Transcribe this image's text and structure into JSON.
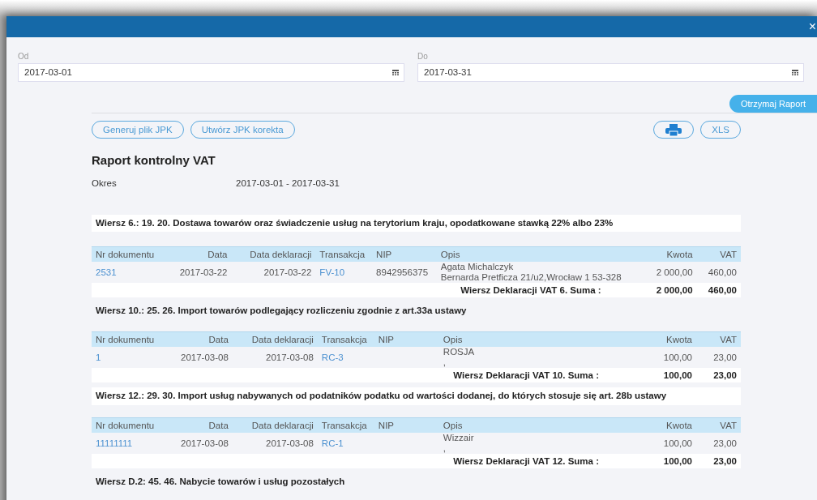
{
  "window": {
    "close": "×"
  },
  "filters": [
    {
      "label": "Od",
      "value": "2017-03-01"
    },
    {
      "label": "Do",
      "value": "2017-03-31"
    }
  ],
  "submit_button": "Otrzymaj Raport",
  "toolbar_buttons": [
    "Generuj plik JPK",
    "Utwórz JPK korekta"
  ],
  "export_button": "XLS",
  "report": {
    "title": "Raport kontrolny VAT",
    "period_label": "Okres",
    "period": "2017-03-01 - 2017-03-31"
  },
  "sections": [
    {
      "heading": "Wiersz 6.: 19. 20. Dostawa towarów oraz świadczenie usług na terytorium kraju, opodatkowane stawką 22% albo 23%",
      "columns": [
        "Nr dokumentu",
        "Data",
        "Data deklaracji",
        "Transakcja",
        "NIP",
        "Opis",
        "Kwota",
        "VAT"
      ],
      "rows": [
        {
          "nr": "2531",
          "data": "2017-03-22",
          "data_deklaracji": "2017-03-22",
          "transakcja": "FV-10",
          "nip": "8942956375",
          "opis": [
            "Agata Michalczyk",
            "Bernarda Pretficza 21/u2,Wrocław 1 53-328"
          ],
          "kwota": "2 000,00",
          "vat": "460,00"
        }
      ],
      "summary": {
        "label": "Wiersz Deklaracji VAT 6. Suma :",
        "kwota": "2 000,00",
        "vat": "460,00"
      }
    },
    {
      "heading": "Wiersz 10.: 25. 26. Import towarów podlegający rozliczeniu zgodnie z art.33a ustawy",
      "columns": [
        "Nr dokumentu",
        "Data",
        "Data deklaracji",
        "Transakcja",
        "NIP",
        "Opis",
        "Kwota",
        "VAT"
      ],
      "rows": [
        {
          "nr": "1",
          "data": "2017-03-08",
          "data_deklaracji": "2017-03-08",
          "transakcja": "RC-3",
          "opis": [
            "ROSJA",
            ","
          ],
          "kwota": "100,00",
          "vat": "23,00"
        }
      ],
      "summary": {
        "label": "Wiersz Deklaracji VAT 10. Suma :",
        "kwota": "100,00",
        "vat": "23,00"
      }
    },
    {
      "heading": "Wiersz 12.: 29. 30. Import usług nabywanych od podatników podatku od wartości dodanej, do których stosuje się art. 28b ustawy",
      "columns": [
        "Nr dokumentu",
        "Data",
        "Data deklaracji",
        "Transakcja",
        "NIP",
        "Opis",
        "Kwota",
        "VAT"
      ],
      "rows": [
        {
          "nr": "11111111",
          "data": "2017-03-08",
          "data_deklaracji": "2017-03-08",
          "transakcja": "RC-1",
          "opis": [
            "Wizzair",
            ","
          ],
          "kwota": "100,00",
          "vat": "23,00"
        }
      ],
      "summary": {
        "label": "Wiersz Deklaracji VAT 12. Suma :",
        "kwota": "100,00",
        "vat": "23,00"
      }
    },
    {
      "heading": "Wiersz D.2: 45. 46. Nabycie towarów i usług pozostałych"
    }
  ]
}
